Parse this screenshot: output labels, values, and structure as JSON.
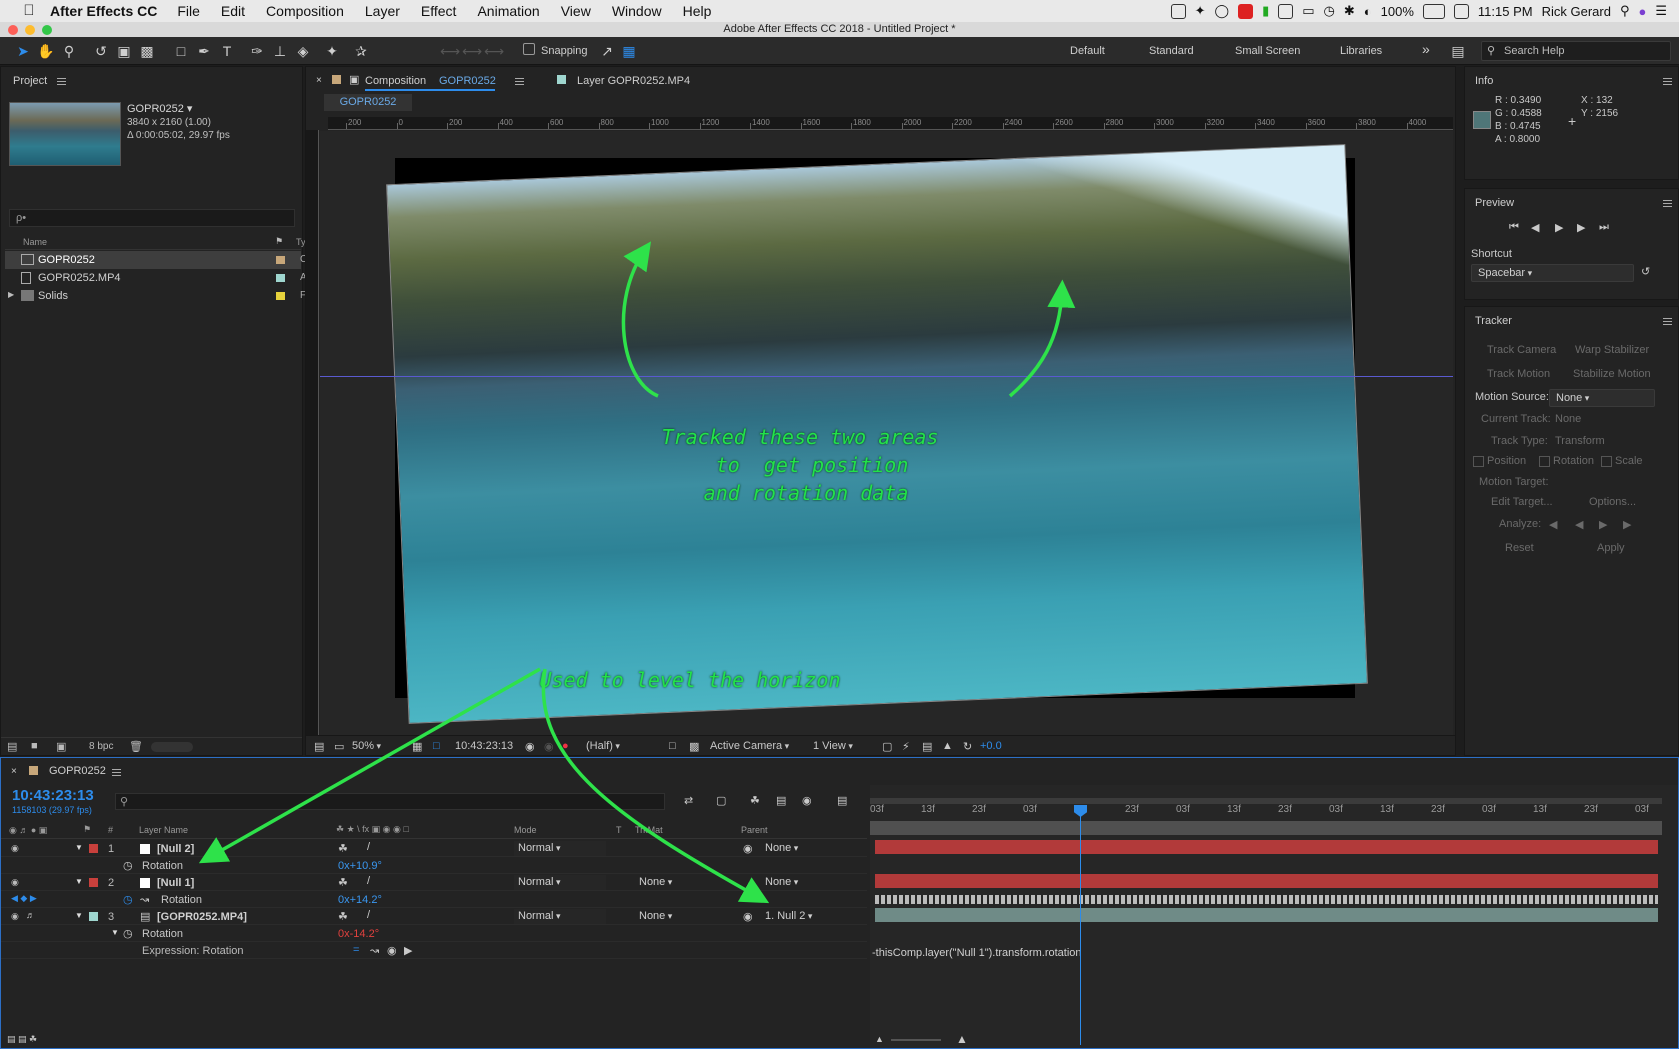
{
  "menubar": {
    "app_name": "After Effects CC",
    "items": [
      "File",
      "Edit",
      "Composition",
      "Layer",
      "Effect",
      "Animation",
      "View",
      "Window",
      "Help"
    ],
    "battery": "100%",
    "clock": "11:15 PM",
    "user": "Rick Gerard"
  },
  "window_title": "Adobe After Effects CC 2018 - Untitled Project *",
  "toolbar": {
    "snapping_label": "Snapping",
    "workspaces": [
      "Default",
      "Standard",
      "Small Screen",
      "Libraries"
    ],
    "search_placeholder": "Search Help"
  },
  "project": {
    "tab_label": "Project",
    "item_name": "GOPR0252 ▾",
    "item_res": "3840 x 2160 (1.00)",
    "item_dur": "Δ 0:00:05:02, 29.97 fps",
    "search_placeholder": "ρ•",
    "col_name": "Name",
    "col_type": "Type",
    "items": [
      {
        "name": "GOPR0252",
        "type": "C",
        "label_color": "#c7a77a"
      },
      {
        "name": "GOPR0252.MP4",
        "type": "A",
        "label_color": "#9fd6cf"
      },
      {
        "name": "Solids",
        "type": "F",
        "label_color": "#e6d23c"
      }
    ],
    "bpc": "8 bpc"
  },
  "composition": {
    "tab_label": "Composition",
    "tab_comp_name": "GOPR0252",
    "layer_tab": "Layer GOPR0252.MP4",
    "subtab": "GOPR0252",
    "ruler_labels": [
      "200",
      "0",
      "200",
      "400",
      "600",
      "800",
      "1000",
      "1200",
      "1400",
      "1600",
      "1800",
      "2000",
      "2200",
      "2400",
      "2600",
      "2800",
      "3000",
      "3200",
      "3400",
      "3600",
      "3800",
      "4000"
    ],
    "annotation_top": "Tracked these two areas\n  to  get position\n and rotation data",
    "annotation_bottom": "Used to level the horizon",
    "zoom": "50%",
    "timecode": "10:43:23:13",
    "resolution": "(Half)",
    "camera": "Active Camera",
    "views": "1 View",
    "exposure": "+0.0"
  },
  "info": {
    "tab_label": "Info",
    "r": "R : 0.3490",
    "g": "G : 0.4588",
    "b": "B : 0.4745",
    "a": "A : 0.8000",
    "x": "X : 132",
    "y": "Y : 2156",
    "swatch": "#4f7678"
  },
  "preview": {
    "tab_label": "Preview",
    "shortcut_label": "Shortcut",
    "shortcut_value": "Spacebar"
  },
  "tracker": {
    "tab_label": "Tracker",
    "track_camera": "Track Camera",
    "warp_stabilizer": "Warp Stabilizer",
    "track_motion": "Track Motion",
    "stabilize_motion": "Stabilize Motion",
    "motion_source_label": "Motion Source:",
    "motion_source_value": "None",
    "current_track_label": "Current Track:",
    "current_track_value": "None",
    "track_type_label": "Track Type:",
    "track_type_value": "Transform",
    "position": "Position",
    "rotation": "Rotation",
    "scale": "Scale",
    "motion_target": "Motion Target:",
    "edit_target": "Edit Target...",
    "options": "Options...",
    "analyze": "Analyze:",
    "reset": "Reset",
    "apply": "Apply"
  },
  "timeline": {
    "tab_label": "GOPR0252",
    "timecode": "10:43:23:13",
    "frames": "1158103 (29.97 fps)",
    "col_layer_name": "Layer Name",
    "col_mode": "Mode",
    "col_t": "T",
    "col_trkmat": "TrkMat",
    "col_parent": "Parent",
    "ruler": [
      "03f",
      "13f",
      "23f",
      "03f",
      "13f",
      "23f",
      "03f",
      "13f",
      "23f",
      "03f",
      "13f",
      "23f",
      "03f",
      "13f",
      "23f",
      "03f"
    ],
    "layers": [
      {
        "num": "1",
        "name": "[Null 2]",
        "label_color": "#c8403c",
        "mode": "Normal",
        "trkmat": "",
        "parent": "None",
        "prop": "Rotation",
        "prop_value": "0x+10.9°",
        "bar_color": "#b23a3a"
      },
      {
        "num": "2",
        "name": "[Null 1]",
        "label_color": "#c8403c",
        "mode": "Normal",
        "trkmat": "None",
        "parent": "None",
        "prop": "Rotation",
        "prop_value": "0x+14.2°",
        "bar_color": "#b23a3a"
      },
      {
        "num": "3",
        "name": "[GOPR0252.MP4]",
        "label_color": "#9fd6cf",
        "mode": "Normal",
        "trkmat": "None",
        "parent": "1. Null 2",
        "prop": "Rotation",
        "prop_value": "0x-14.2°",
        "bar_color": "#6f8b87"
      }
    ],
    "expression_label": "Expression: Rotation",
    "expression_text": "-thisComp.layer(\"Null 1\").transform.rotation"
  }
}
